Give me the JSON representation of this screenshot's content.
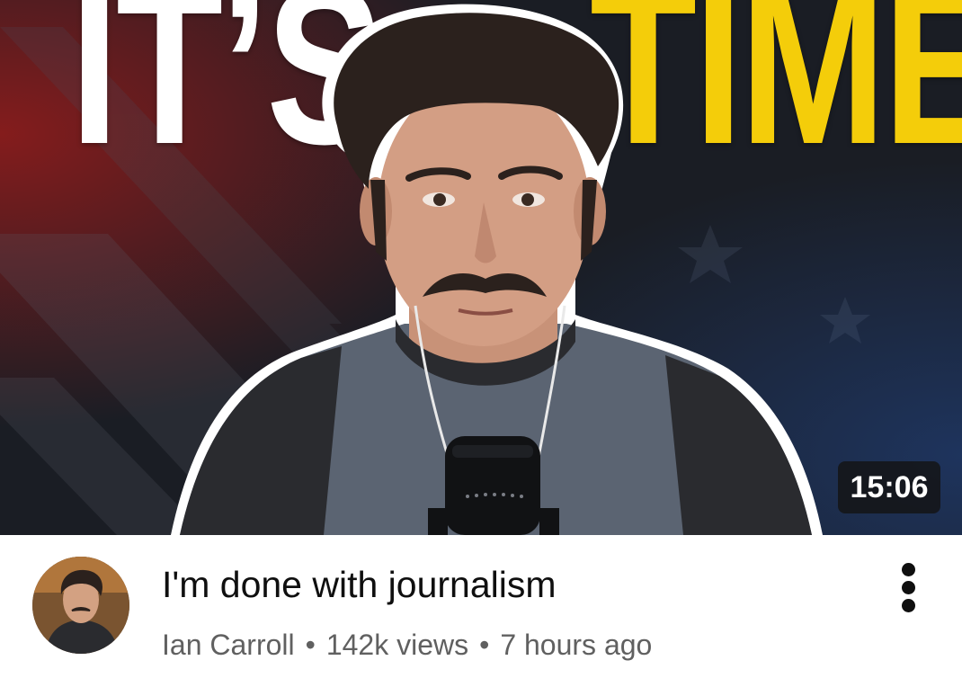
{
  "video": {
    "thumbnail": {
      "headline_left": "IT’S",
      "headline_right": "TIME",
      "duration": "15:06",
      "colors": {
        "background": "#1b1e25",
        "accent_red": "#8a1c1c",
        "accent_blue": "#1e3560",
        "headline_white": "#ffffff",
        "headline_yellow": "#f4cd0a"
      }
    },
    "title": "I'm done with journalism",
    "channel": "Ian Carroll",
    "separator": "•",
    "views": "142k views",
    "age": "7 hours ago",
    "avatar_icon": "channel-avatar",
    "menu_icon": "more-vertical-icon"
  }
}
